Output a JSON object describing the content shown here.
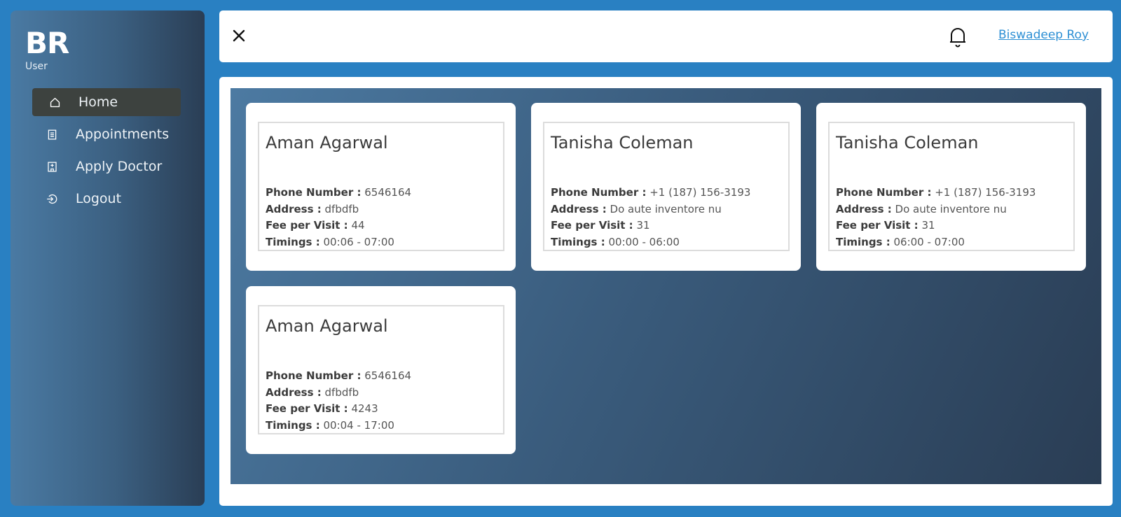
{
  "brand": {
    "initials": "BR",
    "role": "User"
  },
  "menu": [
    {
      "label": "Home",
      "icon": "home-icon",
      "active": true
    },
    {
      "label": "Appointments",
      "icon": "list-icon"
    },
    {
      "label": "Apply Doctor",
      "icon": "hospital-icon"
    },
    {
      "label": "Logout",
      "icon": "logout-icon"
    }
  ],
  "topbar": {
    "user_name": "Biswadeep Roy"
  },
  "labels": {
    "phone": "Phone Number :",
    "address": "Address :",
    "fee": "Fee per Visit :",
    "timings": "Timings :"
  },
  "doctors": [
    {
      "name": "Aman Agarwal",
      "phone": "6546164",
      "address": "dfbdfb",
      "fee": "44",
      "timings": "00:06 - 07:00"
    },
    {
      "name": "Tanisha Coleman",
      "phone": "+1 (187) 156-3193",
      "address": "Do aute inventore nu",
      "fee": "31",
      "timings": "00:00 - 06:00"
    },
    {
      "name": "Tanisha Coleman",
      "phone": "+1 (187) 156-3193",
      "address": "Do aute inventore nu",
      "fee": "31",
      "timings": "06:00 - 07:00"
    },
    {
      "name": "Aman Agarwal",
      "phone": "6546164",
      "address": "dfbdfb",
      "fee": "4243",
      "timings": "00:04 - 17:00"
    }
  ],
  "colors": {
    "background": "#2980c2",
    "link": "#2d8fd4",
    "active_menu": "#3d423f"
  }
}
